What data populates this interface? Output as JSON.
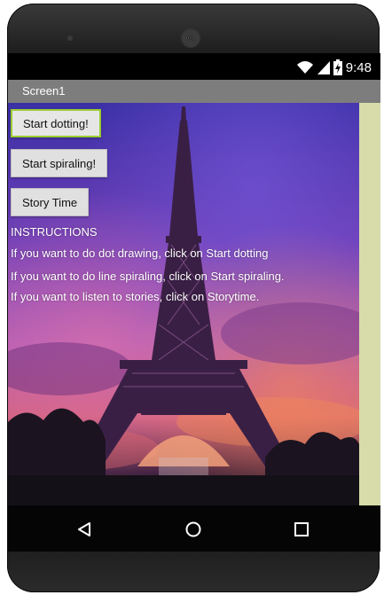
{
  "status_bar": {
    "time": "9:48",
    "icons": [
      "wifi-icon",
      "signal-icon",
      "battery-charging-icon"
    ]
  },
  "title_bar": {
    "title": "Screen1"
  },
  "buttons": {
    "start_dotting": "Start dotting!",
    "start_spiraling": "Start spiraling!",
    "story_time": "Story Time"
  },
  "instructions": {
    "heading": "INSTRUCTIONS",
    "lines": [
      "If you want to do dot drawing, click on Start dotting",
      "If you want to do line spiraling, click on Start spiraling.",
      "If you want to listen to stories, click on Storytime."
    ]
  },
  "navigation": {
    "icons": [
      "back-icon",
      "home-icon",
      "recents-icon"
    ]
  },
  "colors": {
    "title_bar": "#7d7d7d",
    "button_focus_border": "#9acd32",
    "side_panel": "#d7dcaa"
  }
}
